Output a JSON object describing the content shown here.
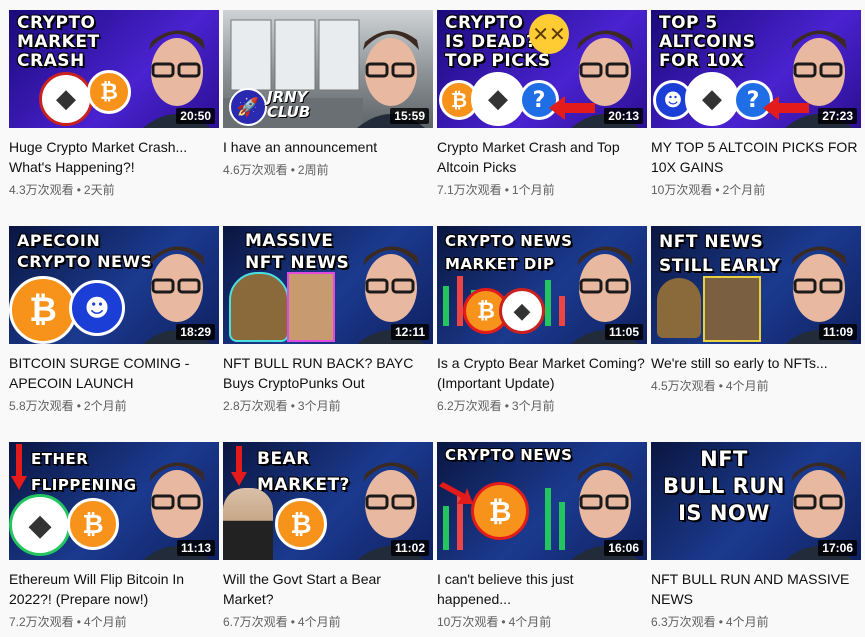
{
  "videos": [
    {
      "headline": "CRYPTO\nMARKET\nCRASH",
      "duration": "20:50",
      "title": "Huge Crypto Market Crash... What's Happening?!",
      "views": "4.3万次观看",
      "age": "2天前",
      "bg": "#3a1fb0",
      "coins": [
        "eth",
        "btc"
      ]
    },
    {
      "headline": "",
      "duration": "15:59",
      "title": "I have an announcement",
      "views": "4.6万次观看",
      "age": "2周前",
      "bg": "#8a8f94",
      "coins": [],
      "logo": "JRNY\nCLUB"
    },
    {
      "headline": "CRYPTO\nIS DEAD?\nTOP PICKS",
      "duration": "20:13",
      "title": "Crypto Market Crash and Top Altcoin Picks",
      "views": "7.1万次观看",
      "age": "1个月前",
      "bg": "#3a1fb0",
      "coins": [
        "btc",
        "eth",
        "q"
      ]
    },
    {
      "headline": "TOP 5\nALTCOINS\nFOR 10X",
      "duration": "27:23",
      "title": "MY TOP 5 ALTCOIN PICKS FOR 10X GAINS",
      "views": "10万次观看",
      "age": "2个月前",
      "bg": "#3a1fb0",
      "coins": [
        "ape",
        "eth",
        "q"
      ]
    },
    {
      "headline": "APECOIN\nCRYPTO NEWS",
      "duration": "18:29",
      "title": "BITCOIN SURGE COMING - APECOIN LAUNCH",
      "views": "5.8万次观看",
      "age": "2个月前",
      "bg": "#1b3a8f",
      "coins": [
        "btc",
        "ape"
      ]
    },
    {
      "headline": "MASSIVE\nNFT NEWS",
      "duration": "12:11",
      "title": "NFT BULL RUN BACK? BAYC Buys CryptoPunks Out",
      "views": "2.8万次观看",
      "age": "3个月前",
      "bg": "#1b3a8f",
      "coins": []
    },
    {
      "headline": "CRYPTO NEWS\nMARKET DIP",
      "duration": "11:05",
      "title": "Is a Crypto Bear Market Coming? (Important Update)",
      "views": "6.2万次观看",
      "age": "3个月前",
      "bg": "#1b3a8f",
      "coins": [
        "btc",
        "eth"
      ]
    },
    {
      "headline": "NFT NEWS\nSTILL EARLY",
      "duration": "11:09",
      "title": "We're still so early to NFTs...",
      "views": "4.5万次观看",
      "age": "4个月前",
      "bg": "#1b3a8f",
      "coins": []
    },
    {
      "headline": "ETHER\nFLIPPENING",
      "duration": "11:13",
      "title": "Ethereum Will Flip Bitcoin In 2022?! (Prepare now!)",
      "views": "7.2万次观看",
      "age": "4个月前",
      "bg": "#1b3a8f",
      "coins": [
        "eth",
        "btc"
      ]
    },
    {
      "headline": "BEAR\nMARKET?",
      "duration": "11:02",
      "title": "Will the Govt Start a Bear Market?",
      "views": "6.7万次观看",
      "age": "4个月前",
      "bg": "#1b3a8f",
      "coins": [
        "btc"
      ]
    },
    {
      "headline": "CRYPTO NEWS",
      "duration": "16:06",
      "title": "I can't believe this just happened...",
      "views": "10万次观看",
      "age": "4个月前",
      "bg": "#1b3a8f",
      "coins": [
        "btc"
      ]
    },
    {
      "headline": "NFT\nBULL RUN\nIS NOW",
      "duration": "17:06",
      "title": "NFT BULL RUN AND MASSIVE NEWS",
      "views": "6.3万次观看",
      "age": "4个月前",
      "bg": "#1b3a8f",
      "coins": []
    }
  ],
  "separator": "•",
  "colors": {
    "duration_bg": "#000000",
    "meta": "#606060",
    "btc": "#f7931a",
    "arrow": "#e31b1b"
  },
  "icons": {
    "btc": "bitcoin-icon",
    "eth": "ethereum-icon",
    "q": "question-icon",
    "ape": "apecoin-icon"
  }
}
